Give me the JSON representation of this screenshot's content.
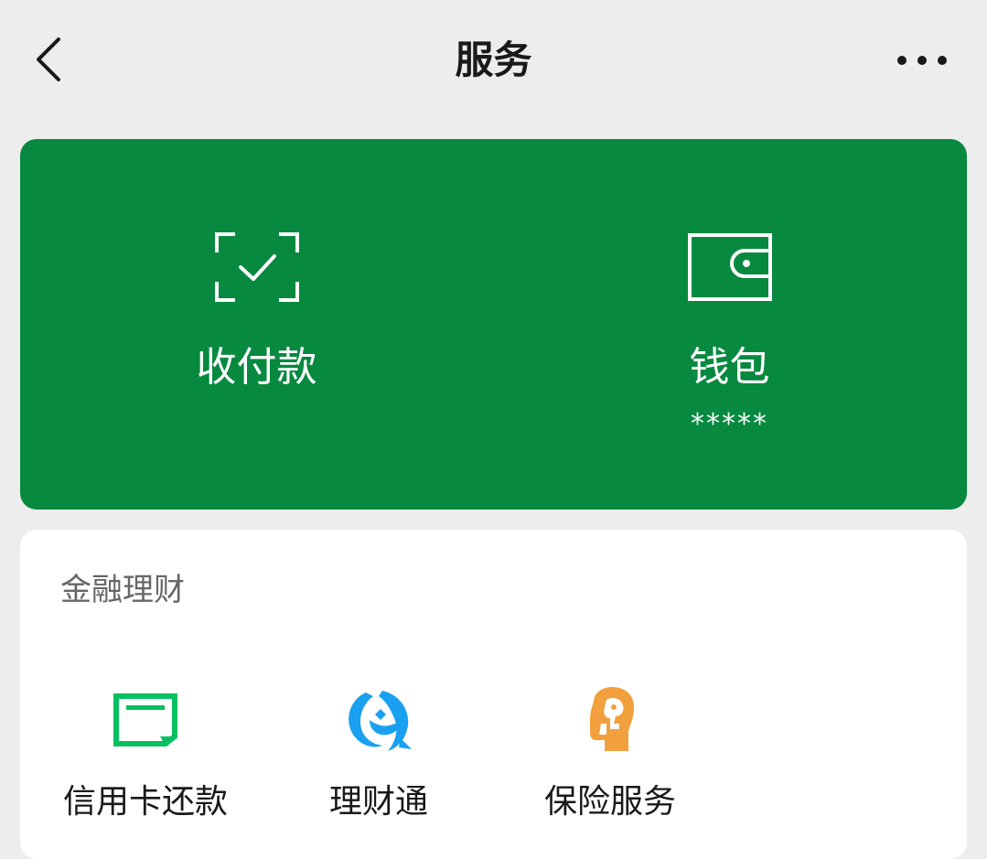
{
  "nav": {
    "title": "服务",
    "back_icon": "chevron-left-icon",
    "more_icon": "more-dots-icon"
  },
  "wallet_card": {
    "background": "#07893f",
    "items": [
      {
        "label": "收付款",
        "icon": "scan-check-icon"
      },
      {
        "label": "钱包",
        "icon": "wallet-icon",
        "sub": "*****"
      }
    ]
  },
  "finance": {
    "title": "金融理财",
    "items": [
      {
        "label": "信用卡还款",
        "icon": "credit-card-icon",
        "color": "#07c160"
      },
      {
        "label": "理财通",
        "icon": "licaitong-icon",
        "color": "#1aa0f0"
      },
      {
        "label": "保险服务",
        "icon": "insurance-icon",
        "color": "#f2a03d"
      }
    ]
  }
}
